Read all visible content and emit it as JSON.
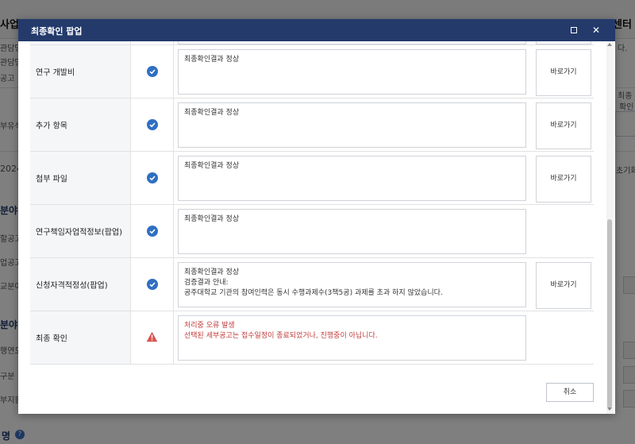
{
  "background": {
    "page_title_left": "사업",
    "page_title_right": "센터",
    "right_note": "다.",
    "left_fragments": [
      "관담당",
      "관담당",
      "공고",
      "부유식",
      "2024",
      "분야",
      "할공고",
      "업공고",
      "교분야",
      "분야",
      "행연도",
      "구분",
      "부지원"
    ],
    "section_a": "분야",
    "section_b": "분야",
    "right_header": [
      "최종",
      "확인"
    ],
    "reset_label": "초기화",
    "bottom_label": "명",
    "help_glyph": "?"
  },
  "modal": {
    "title": "최종확인 팝업",
    "maximize_glyph": "□",
    "close_glyph": "✕",
    "rows": [
      {
        "name": "연구 개발비",
        "status": "ok",
        "lines": [
          "최종확인결과 정상"
        ],
        "button": "바로가기"
      },
      {
        "name": "추가 항목",
        "status": "ok",
        "lines": [
          "최종확인결과 정상"
        ],
        "button": "바로가기"
      },
      {
        "name": "첨부 파일",
        "status": "ok",
        "lines": [
          "최종확인결과 정상"
        ],
        "button": "바로가기"
      },
      {
        "name": "연구책임자업적정보(팝업)",
        "status": "ok",
        "lines": [
          "최종확인결과 정상"
        ],
        "button": ""
      },
      {
        "name": "신청자격적정성(팝업)",
        "status": "ok",
        "lines": [
          "최종확인결과 정상",
          "검증결과 안내:",
          "공주대학교 기관의 참여인력은 동시 수행과제수(3책5공) 과제를 초과 하지 않았습니다."
        ],
        "button": "바로가기"
      },
      {
        "name": "최종 확인",
        "status": "error",
        "lines": [
          "처리중 오류 발생",
          "선택된 세부공고는 접수일정이 종료되었거나, 진행중이 아닙니다."
        ],
        "button": ""
      }
    ],
    "cancel_label": "취소"
  },
  "colors": {
    "header_bg": "#233a6b",
    "check_blue": "#2f6fc3",
    "warn_red": "#d9534f",
    "error_text": "#c23a3a"
  }
}
